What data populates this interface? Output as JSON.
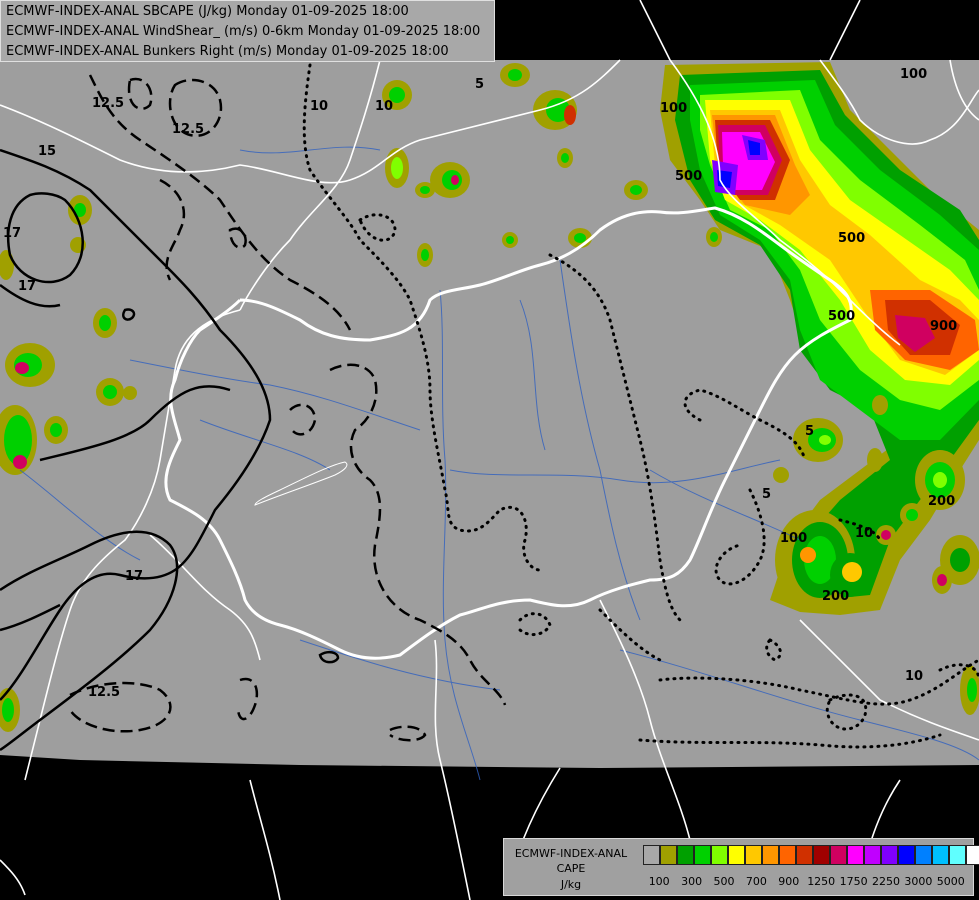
{
  "header": {
    "line1": "ECMWF-INDEX-ANAL SBCAPE (J/kg) Monday 01-09-2025 18:00",
    "line2": "ECMWF-INDEX-ANAL WindShear_ (m/s) 0-6km Monday 01-09-2025 18:00",
    "line3": "ECMWF-INDEX-ANAL Bunkers Right (m/s) Monday 01-09-2025 18:00"
  },
  "legend": {
    "title_line1": "ECMWF-INDEX-ANAL",
    "title_line2": "CAPE",
    "unit": "J/kg",
    "colors": [
      "#a8a8a8",
      "#a0a000",
      "#00a000",
      "#00d000",
      "#80ff00",
      "#ffff00",
      "#ffc800",
      "#ff9600",
      "#ff6400",
      "#d03000",
      "#a00000",
      "#d00060",
      "#ff00ff",
      "#c000ff",
      "#8000ff",
      "#0000ff",
      "#0080ff",
      "#00c0ff",
      "#60ffff",
      "#ffffff"
    ],
    "ticks": [
      "100",
      "300",
      "500",
      "700",
      "900",
      "1250",
      "1750",
      "2250",
      "3000",
      "5000"
    ]
  },
  "contour_labels": [
    {
      "text": "12.5",
      "kind": "shear"
    },
    {
      "text": "12.5",
      "kind": "shear"
    },
    {
      "text": "12.5",
      "kind": "shear"
    },
    {
      "text": "15",
      "kind": "shear"
    },
    {
      "text": "17",
      "kind": "shear"
    },
    {
      "text": "17",
      "kind": "shear"
    },
    {
      "text": "17",
      "kind": "shear"
    },
    {
      "text": "10",
      "kind": "bunkers"
    },
    {
      "text": "10",
      "kind": "bunkers"
    },
    {
      "text": "10",
      "kind": "bunkers"
    },
    {
      "text": "10",
      "kind": "bunkers"
    },
    {
      "text": "5",
      "kind": "bunkers"
    },
    {
      "text": "5",
      "kind": "bunkers"
    },
    {
      "text": "5",
      "kind": "bunkers"
    },
    {
      "text": "100",
      "kind": "cape"
    },
    {
      "text": "100",
      "kind": "cape"
    },
    {
      "text": "100",
      "kind": "cape"
    },
    {
      "text": "500",
      "kind": "cape"
    },
    {
      "text": "500",
      "kind": "cape"
    },
    {
      "text": "500",
      "kind": "cape"
    },
    {
      "text": "200",
      "kind": "cape"
    },
    {
      "text": "200",
      "kind": "cape"
    },
    {
      "text": "900",
      "kind": "cape"
    }
  ]
}
